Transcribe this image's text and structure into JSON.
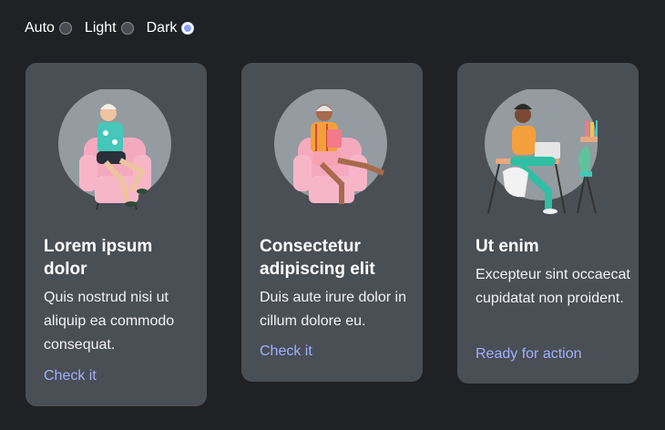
{
  "theme": {
    "options": [
      "Auto",
      "Light",
      "Dark"
    ],
    "selected": "Dark"
  },
  "cards": [
    {
      "title": "Lorem ipsum dolor",
      "body": "Quis nostrud nisi ut aliquip ea commodo consequat.",
      "link": "Check it",
      "illustration": "person-sitting-armchair-icon"
    },
    {
      "title": "Consectetur adipiscing elit",
      "body": "Duis aute irure dolor in cillum dolore eu.",
      "link": "Check it",
      "illustration": "person-reading-armchair-icon"
    },
    {
      "title": "Ut enim",
      "body": "Excepteur sint occaecat cupidatat non proident.",
      "link": "Ready for action",
      "illustration": "person-at-desk-laptop-icon"
    }
  ],
  "colors": {
    "background": "#202124",
    "card": "#4a4e55",
    "link": "#9fb0ff",
    "illustration_circle": "#949ba1"
  }
}
